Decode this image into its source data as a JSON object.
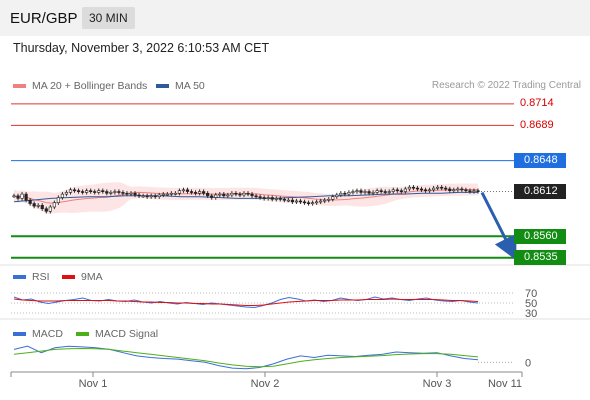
{
  "header": {
    "symbol": "EUR/GBP",
    "interval": "30 MIN"
  },
  "datetime": "Thursday, November 3, 2022 6:10:53 AM CET",
  "legend_main": [
    {
      "label": "MA 20 + Bollinger Bands",
      "color": "#f08080"
    },
    {
      "label": "MA 50",
      "color": "#2e5b9a"
    }
  ],
  "credit": "Research © 2022 Trading Central",
  "levels": [
    {
      "value": "0.8714",
      "kind": "resistance",
      "color": "#e03030"
    },
    {
      "value": "0.8689",
      "kind": "resistance",
      "color": "#e03030"
    },
    {
      "value": "0.8648",
      "kind": "pivot",
      "color": "#1f6fe0"
    },
    {
      "value": "0.8612",
      "kind": "last",
      "color": "#222222"
    },
    {
      "value": "0.8560",
      "kind": "support",
      "color": "#128c12"
    },
    {
      "value": "0.8535",
      "kind": "support",
      "color": "#128c12"
    }
  ],
  "legend_rsi": [
    {
      "label": "RSI",
      "color": "#3a6fd8"
    },
    {
      "label": "9MA",
      "color": "#e01010"
    }
  ],
  "rsi_levels": [
    "70",
    "50",
    "30"
  ],
  "legend_macd": [
    {
      "label": "MACD",
      "color": "#3a6fd8"
    },
    {
      "label": "MACD Signal",
      "color": "#4caf1a"
    }
  ],
  "macd_zero": "0",
  "x_axis": [
    "Nov 1",
    "Nov 2",
    "Nov 3",
    "Nov 11"
  ],
  "chart_data": {
    "type": "candlestick",
    "symbol": "EUR/GBP",
    "interval": "30 MIN",
    "price_levels": [
      0.8714,
      0.8689,
      0.8648,
      0.8612,
      0.856,
      0.8535
    ],
    "last_price": 0.8612,
    "forecast_direction": "down",
    "forecast_target": 0.8535,
    "close_series": [
      0.8607,
      0.8604,
      0.8609,
      0.8602,
      0.8598,
      0.8595,
      0.8596,
      0.8592,
      0.8589,
      0.8594,
      0.8599,
      0.8605,
      0.8609,
      0.8611,
      0.8614,
      0.8613,
      0.8612,
      0.8611,
      0.8613,
      0.8612,
      0.8611,
      0.8613,
      0.8612,
      0.861,
      0.8611,
      0.8612,
      0.8611,
      0.861,
      0.8609,
      0.861,
      0.8608,
      0.8607,
      0.8607,
      0.8606,
      0.8607,
      0.8606,
      0.8608,
      0.8609,
      0.8609,
      0.861,
      0.861,
      0.8613,
      0.8614,
      0.8612,
      0.8611,
      0.861,
      0.8612,
      0.861,
      0.8607,
      0.8605,
      0.8608,
      0.8609,
      0.8607,
      0.8608,
      0.861,
      0.8609,
      0.8608,
      0.861,
      0.8609,
      0.8607,
      0.8606,
      0.8605,
      0.8604,
      0.8605,
      0.8603,
      0.8604,
      0.8603,
      0.8602,
      0.8602,
      0.86,
      0.8601,
      0.86,
      0.8599,
      0.8598,
      0.8599,
      0.86,
      0.8601,
      0.8602,
      0.8603,
      0.8606,
      0.8608,
      0.861,
      0.8609,
      0.8611,
      0.8612,
      0.8613,
      0.8611,
      0.8612,
      0.861,
      0.8611,
      0.8613,
      0.8612,
      0.8611,
      0.8612,
      0.8614,
      0.8613,
      0.8612,
      0.8615,
      0.8617,
      0.8616,
      0.8615,
      0.8614,
      0.8613,
      0.8614,
      0.8616,
      0.8617,
      0.8616,
      0.8615,
      0.8613,
      0.8614,
      0.8615,
      0.8614,
      0.8613,
      0.8612,
      0.8613,
      0.8612
    ],
    "ma50_series": [
      0.86,
      0.8602,
      0.8604,
      0.8605,
      0.8606,
      0.8606,
      0.8607,
      0.8607,
      0.8607,
      0.8606,
      0.8606,
      0.8605,
      0.8604,
      0.8604,
      0.8604,
      0.8605,
      0.8606,
      0.8607,
      0.8607,
      0.8608,
      0.8609,
      0.8609,
      0.861,
      0.861,
      0.8611,
      0.8611
    ],
    "rsi_series": [
      62,
      56,
      58,
      52,
      49,
      52,
      55,
      57,
      60,
      55,
      54,
      57,
      54,
      53,
      56,
      52,
      50,
      53,
      50,
      48,
      51,
      49,
      47,
      50,
      48,
      46,
      44,
      42,
      41,
      45,
      50,
      57,
      61,
      58,
      54,
      56,
      53,
      55,
      60,
      57,
      55,
      57,
      62,
      58,
      60,
      57,
      55,
      58,
      60,
      56,
      54,
      53,
      55,
      52,
      50
    ],
    "rsi_ma_series": [
      58,
      56,
      55,
      54,
      54,
      54,
      55,
      55,
      55,
      55,
      55,
      55,
      54,
      54,
      53,
      52,
      52,
      51,
      51,
      50,
      50,
      49,
      49,
      48,
      48,
      47,
      46,
      45,
      45,
      46,
      48,
      50,
      52,
      53,
      54,
      55,
      55,
      55,
      56,
      56,
      56,
      57,
      57,
      57,
      58,
      57,
      57,
      57,
      57,
      57,
      56,
      55,
      55,
      54,
      53
    ],
    "macd_series": [
      0.0004,
      0.0005,
      0.0003,
      0.00045,
      0.0005,
      0.00048,
      0.00045,
      0.0004,
      0.0003,
      0.0002,
      0.00015,
      0.00012,
      0.0001,
      5e-05,
      0.0,
      -0.0001,
      -0.00018,
      -0.0002,
      -0.00016,
      -5e-05,
      0.0001,
      0.0002,
      0.00015,
      0.00022,
      0.0002,
      0.00018,
      0.00022,
      0.00025,
      0.00032,
      0.0003,
      0.00028,
      0.0003,
      0.0002,
      0.00012,
      8e-05
    ],
    "macd_signal_series": [
      0.00025,
      0.0003,
      0.00035,
      0.0004,
      0.00042,
      0.00043,
      0.00042,
      0.0004,
      0.00035,
      0.0003,
      0.00025,
      0.0002,
      0.00015,
      0.0001,
      5e-05,
      -2e-05,
      -8e-05,
      -0.00012,
      -0.00014,
      -0.00012,
      -5e-05,
      3e-05,
      8e-05,
      0.00012,
      0.00015,
      0.00017,
      0.00019,
      0.00021,
      0.00024,
      0.00026,
      0.00027,
      0.00027,
      0.00025,
      0.00021,
      0.00017
    ]
  }
}
